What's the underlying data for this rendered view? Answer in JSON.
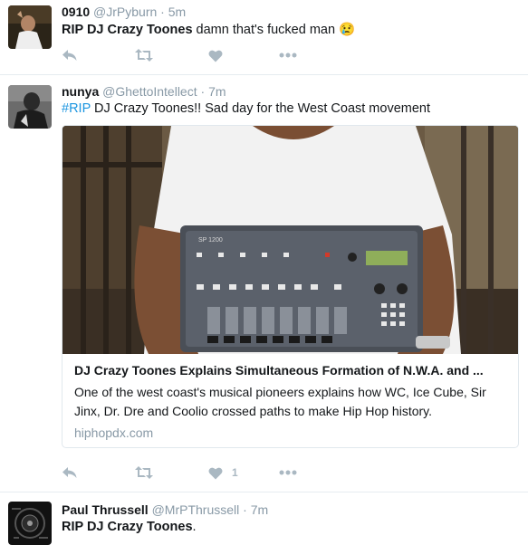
{
  "tweets": [
    {
      "fullname": "0910",
      "handle": "@JrPyburn",
      "separator": "·",
      "time": "5m",
      "text_bold": "RIP DJ Crazy Toones",
      "text_rest": " damn that's fucked man ",
      "emoji": "😢"
    },
    {
      "fullname": "nunya",
      "handle": "@GhettoIntellect",
      "separator": "·",
      "time": "7m",
      "hashtag": "#RIP",
      "text_rest": " DJ Crazy Toones!! Sad day for the West Coast movement",
      "card": {
        "title": "DJ Crazy Toones Explains Simultaneous Formation of N.W.A. and ...",
        "description": "One of the west coast's musical pioneers explains how WC, Ice Cube, Sir Jinx, Dr. Dre and Coolio crossed paths to make Hip Hop history.",
        "domain": "hiphopdx.com",
        "device_label": "SP 1200"
      },
      "like_count": "1"
    },
    {
      "fullname": "Paul Thrussell",
      "handle": "@MrPThrussell",
      "separator": "·",
      "time": "7m",
      "text_bold": "RIP DJ Crazy Toones",
      "text_rest": "."
    }
  ],
  "icons": {
    "reply": "reply-icon",
    "retweet": "retweet-icon",
    "like": "heart-icon",
    "more": "more-icon"
  },
  "colors": {
    "icon": "#aab8c2",
    "link": "#1b95e0",
    "muted": "#8899a6"
  }
}
